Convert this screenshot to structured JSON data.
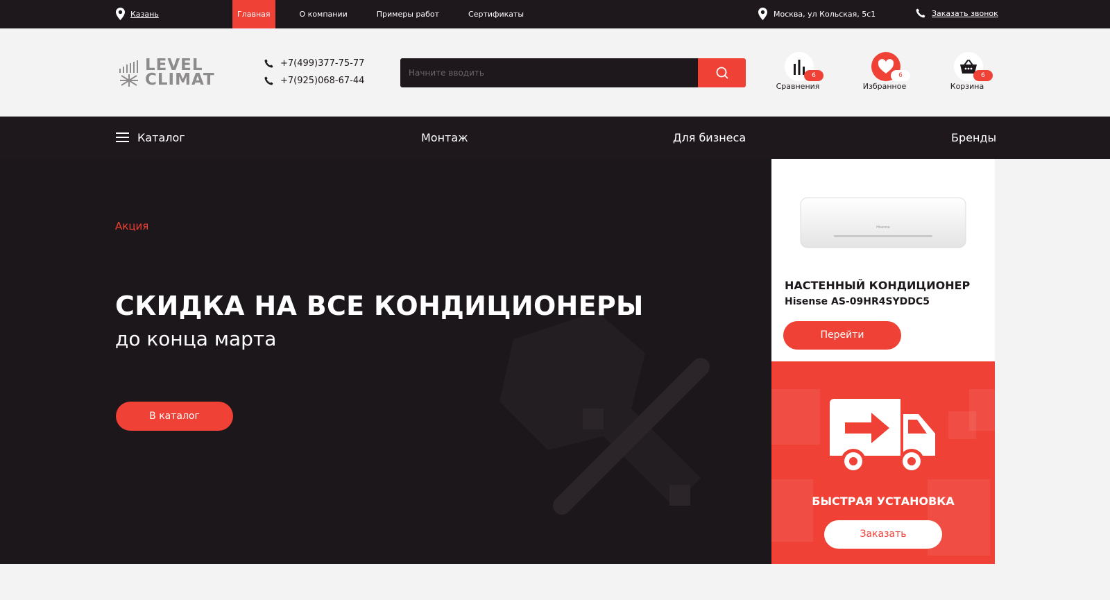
{
  "topbar": {
    "city": "Казань",
    "nav": [
      "Главная",
      "О компании",
      "Примеры работ",
      "Сертификаты"
    ],
    "address": "Москва, ул Кольская, 5с1",
    "callback": "Заказать звонок"
  },
  "header": {
    "logo_line1": "LEVEL",
    "logo_line2": "CLIMAT",
    "phones": [
      "+7(499)377-75-77",
      "+7(925)068-67-44"
    ],
    "search_placeholder": "Начните вводить",
    "compare": {
      "label": "Сравнения",
      "count": "6"
    },
    "favorites": {
      "label": "Избранное",
      "count": "6"
    },
    "cart": {
      "label": "Корзина",
      "count": "6"
    }
  },
  "mainnav": {
    "catalog": "Каталог",
    "montage": "Монтаж",
    "business": "Для бизнеса",
    "brands": "Бренды"
  },
  "hero": {
    "promo": "Акция",
    "title": "СКИДКА НА ВСЕ КОНДИЦИОНЕРЫ",
    "subtitle": "до конца марта",
    "button": "В каталог"
  },
  "product": {
    "title": "НАСТЕННЫЙ КОНДИЦИОНЕР",
    "model": "Hisense AS-09HR4SYDDC5",
    "brand_mark": "Hisense",
    "button": "Перейти"
  },
  "delivery": {
    "title": "БЫСТРАЯ УСТАНОВКА",
    "button": "Заказать"
  },
  "colors": {
    "accent": "#ef4136",
    "dark": "#1e181d",
    "light_bg": "#f4f3f3"
  },
  "icons": [
    "location-pin-icon",
    "phone-icon",
    "search-icon",
    "compare-bars-icon",
    "heart-icon",
    "basket-icon",
    "burger-menu-icon",
    "truck-arrow-icon"
  ]
}
